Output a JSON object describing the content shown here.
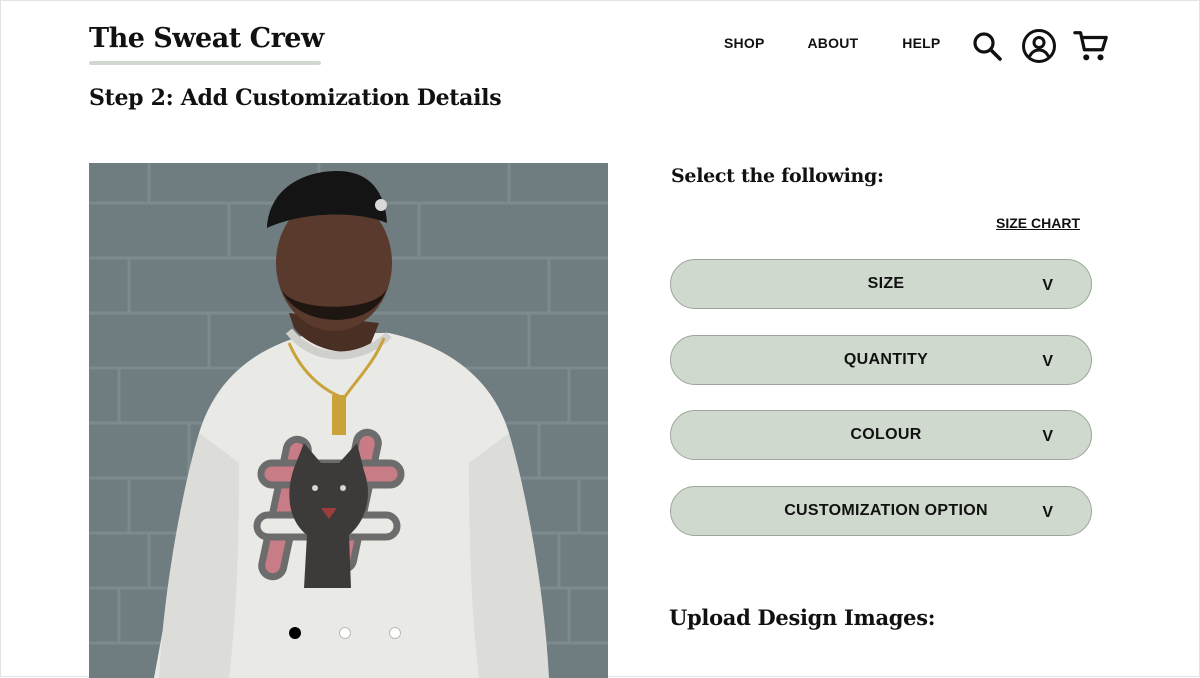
{
  "brand": {
    "name": "The Sweat Crew",
    "underline_color": "#cfd9cd"
  },
  "nav": {
    "items": [
      {
        "label": "SHOP"
      },
      {
        "label": "ABOUT"
      },
      {
        "label": "HELP"
      }
    ],
    "icons": [
      "search-icon",
      "account-icon",
      "cart-icon"
    ]
  },
  "page": {
    "title": "Step 2: Add Customization Details"
  },
  "gallery": {
    "image_subject": "man wearing white sweatshirt with hashtag wolf graphic",
    "slides_total": 3,
    "active_slide": 1
  },
  "options": {
    "heading": "Select the following:",
    "size_chart_label": "SIZE CHART",
    "dropdowns": [
      {
        "label": "SIZE",
        "chevron": "V"
      },
      {
        "label": "QUANTITY",
        "chevron": "V"
      },
      {
        "label": "COLOUR",
        "chevron": "V"
      },
      {
        "label": "CUSTOMIZATION OPTION",
        "chevron": "V"
      }
    ],
    "dropdown_color": "#cfd9cd"
  },
  "upload": {
    "heading": "Upload Design Images:"
  }
}
